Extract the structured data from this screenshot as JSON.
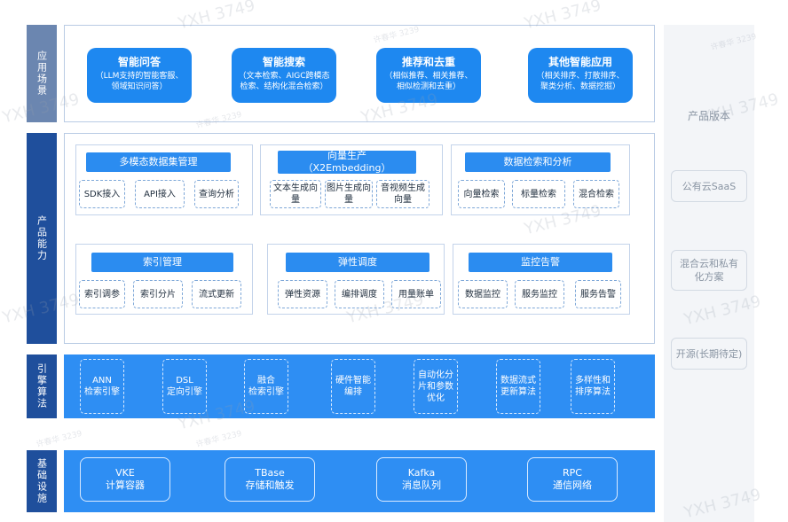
{
  "rows": {
    "application": "应用场景",
    "capability": "产品能力",
    "engine": "引擎算法",
    "infrastructure": "基础设施"
  },
  "applications": [
    {
      "title": "智能问答",
      "sub": "（LLM支持的智能客服、领域知识问答）"
    },
    {
      "title": "智能搜索",
      "sub": "（文本检索、AIGC跨模态检索、结构化混合检索）"
    },
    {
      "title": "推荐和去重",
      "sub": "（相似推荐、相关推荐、相似检测和去重）"
    },
    {
      "title": "其他智能应用",
      "sub": "（相关排序、打散排序、聚类分析、数据挖掘）"
    }
  ],
  "capabilities": {
    "dataset": {
      "title": "多模态数据集管理",
      "items": [
        "SDK接入",
        "API接入",
        "查询分析"
      ]
    },
    "embedding": {
      "title": "向量生产",
      "title2": "（X2Embedding）",
      "items": [
        "文本生成向量",
        "图片生成向量",
        "音视频生成向量"
      ]
    },
    "search": {
      "title": "数据检索和分析",
      "items": [
        "向量检索",
        "标量检索",
        "混合检索"
      ]
    },
    "index": {
      "title": "索引管理",
      "items": [
        "索引调参",
        "索引分片",
        "流式更新"
      ]
    },
    "elastic": {
      "title": "弹性调度",
      "items": [
        "弹性资源",
        "编排调度",
        "用量账单"
      ]
    },
    "monitor": {
      "title": "监控告警",
      "items": [
        "数据监控",
        "服务监控",
        "服务告警"
      ]
    }
  },
  "engines": [
    [
      "ANN",
      "检索引擎"
    ],
    [
      "DSL",
      "定向引擎"
    ],
    [
      "融合",
      "检索引擎"
    ],
    [
      "硬件智能",
      "编排"
    ],
    [
      "自动化分",
      "片和参数",
      "优化"
    ],
    [
      "数据流式",
      "更新算法"
    ],
    [
      "多样性和",
      "排序算法"
    ]
  ],
  "infrastructure": [
    {
      "name": "VKE",
      "desc": "计算容器"
    },
    {
      "name": "TBase",
      "desc": "存储和触发"
    },
    {
      "name": "Kafka",
      "desc": "消息队列"
    },
    {
      "name": "RPC",
      "desc": "通信网络"
    }
  ],
  "versions": {
    "title": "产品版本",
    "items": [
      "公有云SaaS",
      "混合云和私有化方案",
      "开源(长期待定)"
    ]
  },
  "watermark": {
    "big": "YXH 3749",
    "small": "许春华 3239"
  },
  "colors": {
    "band": "#2e8ef3",
    "label": "#2d5aa8",
    "pill": "#1e88f0",
    "frame": "#b9cbe4"
  }
}
